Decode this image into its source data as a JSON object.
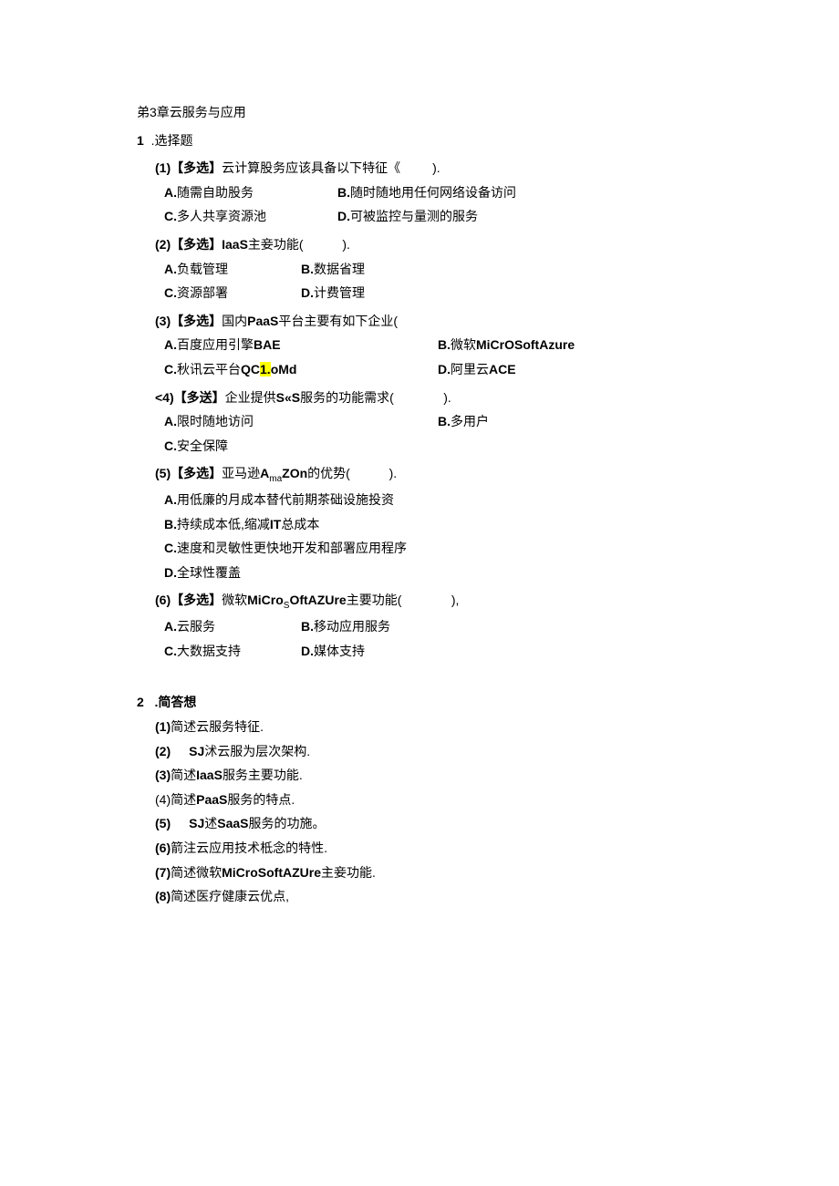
{
  "chapter": "弟3章云服务与应用",
  "section1": {
    "num": "1",
    "title": ".选择题",
    "q1": {
      "text_prefix": "(1)【多选】",
      "text_body": "云计算股务应该具备以下特征《",
      "text_suffix": ").",
      "a": {
        "p": "A.",
        "t": "随需自助股务"
      },
      "b": {
        "p": "B.",
        "t": "随时随地用任何网络设备访问"
      },
      "c": {
        "p": "C.",
        "t": "多人共享资源池"
      },
      "d": {
        "p": "D.",
        "t": "可被监控与量测的服务"
      }
    },
    "q2": {
      "text_prefix": "(2)【多选】IaaS",
      "text_body": "主妾功能(",
      "text_suffix": ").",
      "a": {
        "p": "A.",
        "t": "负载管理"
      },
      "b": {
        "p": "B.",
        "t": "数据省理"
      },
      "c": {
        "p": "C.",
        "t": "资源部署"
      },
      "d": {
        "p": "D.",
        "t": "计费管理"
      }
    },
    "q3": {
      "text_prefix": "(3)【多选】",
      "text_body1": "国内",
      "text_bold": "PaaS",
      "text_body2": "平台主要有如下企业(",
      "a": {
        "p": "A.",
        "t1": "百度应用引擎",
        "t2": "BAE"
      },
      "b": {
        "p": "B.",
        "t1": "微软",
        "t2": "MiCrOSoftAzure"
      },
      "c": {
        "p": "C.",
        "t1": "秋讯云平台",
        "t2a": "QC",
        "hl": "1.",
        "t2b": "oMd"
      },
      "d": {
        "p": "D.",
        "t1": "阿里云",
        "t2": "ACE"
      }
    },
    "q4": {
      "text_prefix": "<4)【多送】",
      "text_body1": "企业提供",
      "text_bold": "S«S",
      "text_body2": "服务的功能需求(",
      "text_suffix": ").",
      "a": {
        "p": "A.",
        "t": "限时随地访问"
      },
      "b": {
        "p": "B.",
        "t": "多用户"
      },
      "c": {
        "p": "C.",
        "t": "安全保障"
      }
    },
    "q5": {
      "text_prefix": "(5)【多选】",
      "text_body1": "亚马逊",
      "text_bold1": "A",
      "text_sub": "ma",
      "text_bold2": "ZOn",
      "text_body2": "的优势(",
      "text_suffix": ").",
      "a": {
        "p": "A.",
        "t": "用低廉的月成本替代前期茶础设施投资"
      },
      "b": {
        "p": "B.",
        "t1": "持续成本低,缩减",
        "tb": "IT",
        "t2": "总成本"
      },
      "c": {
        "p": "C.",
        "t": "速度和灵敏性更快地开发和部署应用程序"
      },
      "d": {
        "p": "D.",
        "t": "全球性覆盖"
      }
    },
    "q6": {
      "text_prefix": "(6)【多选】",
      "text_body1": "微软",
      "text_bold1": "MiCro",
      "text_sub": "S",
      "text_bold2": "OftAZUre",
      "text_body2": "主要功能(",
      "text_suffix": "),",
      "a": {
        "p": "A.",
        "t": "云服务"
      },
      "b": {
        "p": "B.",
        "t": "移动应用服务"
      },
      "c": {
        "p": "C.",
        "t": "大数据支持"
      },
      "d": {
        "p": "D.",
        "t": "媒体支持"
      }
    }
  },
  "section2": {
    "num": "2",
    "title": ".简答想",
    "items": {
      "i1": {
        "n": "(1)",
        "t": "简述云服务特征."
      },
      "i2": {
        "n": "(2)",
        "sj": "SJ",
        "t": "沭云服为层次架构."
      },
      "i3": {
        "n": "(3)",
        "t1": "简述",
        "tb": "IaaS",
        "t2": "服务主要功能."
      },
      "i4": {
        "n": "(4)",
        "t1": "简述",
        "tb": "PaaS",
        "t2": "服务的特点."
      },
      "i5": {
        "n": "(5)",
        "sj": "SJ",
        "t1": "述",
        "tb": "SaaS",
        "t2": "服务的功施。"
      },
      "i6": {
        "n": "(6)",
        "t": "箭注云应用技术柢念的特性."
      },
      "i7": {
        "n": "(7)",
        "t1": "简述微软",
        "tb": "MiCroSoftAZUre",
        "t2": "主妾功能."
      },
      "i8": {
        "n": "(8)",
        "t": "简述医疗健康云优点,"
      }
    }
  }
}
